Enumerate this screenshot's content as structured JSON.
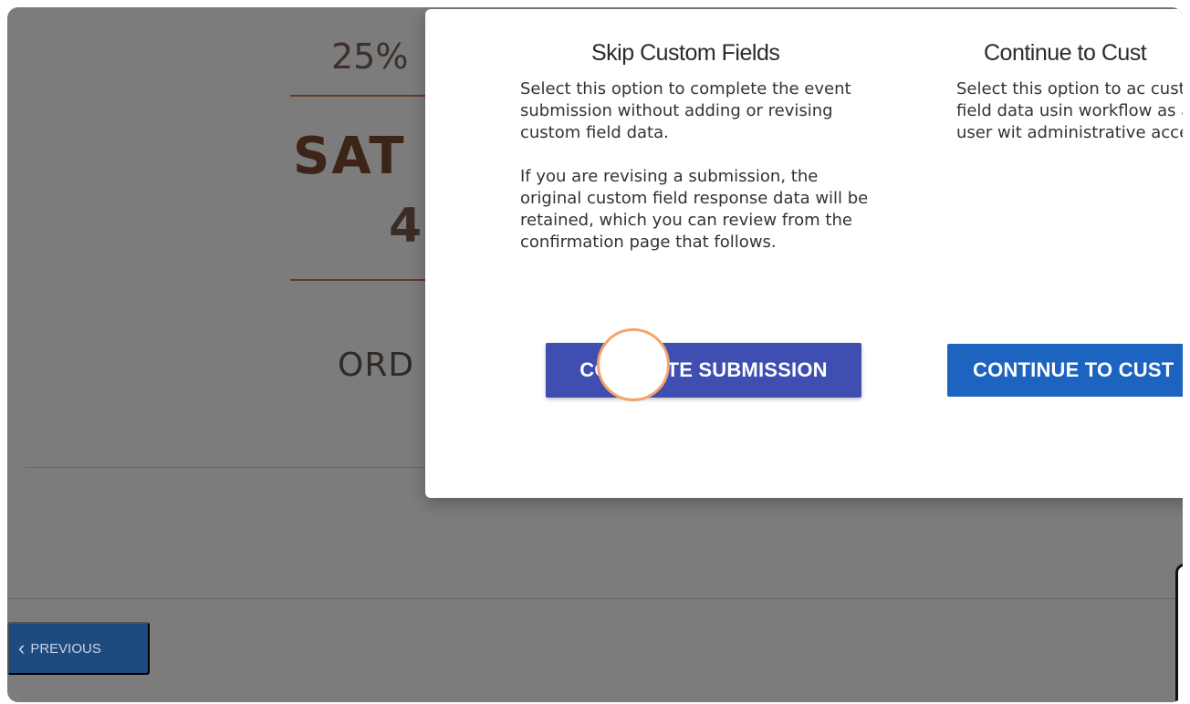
{
  "background": {
    "percent_text": "25%",
    "day_text": "SAT",
    "date_text": "4",
    "order_text": "ORD",
    "previous_button_label": "PREVIOUS"
  },
  "modal": {
    "skip": {
      "title": "Skip Custom Fields",
      "paragraph_1": "Select this option to complete the event submission without adding or revising custom field data.",
      "paragraph_2": "If you are revising a submission, the original custom field response data will be retained, which you can review from the confirmation page that follows.",
      "button_label": "COMPLETE SUBMISSION"
    },
    "continue": {
      "title": "Continue to Cust",
      "paragraph_1": "Select this option to ac custom field data usin workflow as a user wit administrative access.",
      "button_label": "CONTINUE TO CUST"
    }
  },
  "colors": {
    "complete_button": "#3f4fb1",
    "continue_button": "#1d64c0",
    "previous_button": "#1f4a80",
    "cursor_ring": "#f3a46a"
  },
  "icons": {
    "previous": "chevron-left-icon",
    "cursor": "click-indicator"
  }
}
